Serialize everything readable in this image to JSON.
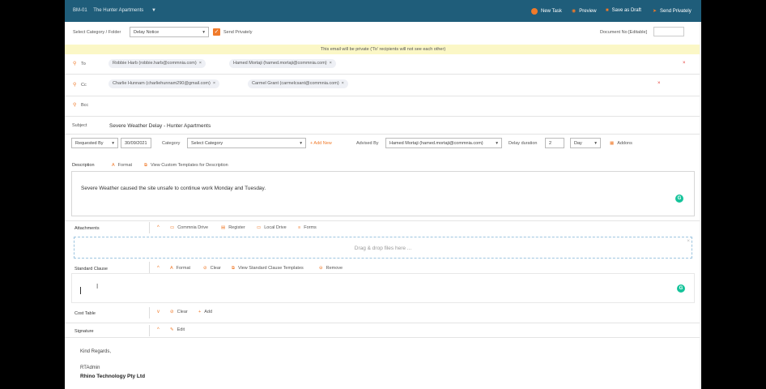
{
  "topbar": {
    "code": "BM-01",
    "project": "The Hunter Apartments",
    "actions": {
      "new_task": "New Task",
      "preview": "Preview",
      "save_draft": "Save as Draft",
      "send_privately": "Send Privately"
    }
  },
  "form": {
    "category_label": "Select Category / Folder",
    "category_value": "Delay Notice",
    "send_privately_label": "Send Privately",
    "document_no_label": "Document No [Editable]",
    "private_banner": "This email will be private ('To' recipients will not see each other)",
    "to_label": "To",
    "to_recipients": [
      "Robbie Harb (robbie.harb@commnia.com)",
      "Hamed Mortaji (hamed.mortaji@commnia.com)"
    ],
    "cc_label": "Cc",
    "cc_recipients": [
      "Charlie Hunnam (charliehunnam290@gmail.com)",
      "Carmel Grant (carmelcsant@commnia.com)"
    ],
    "bcc_label": "Bcc",
    "subject_label": "Subject",
    "subject_value": "Severe Weather Delay - Hunter Apartments",
    "requested_by_value": "Requested By",
    "date_value": "30/09/2021",
    "category2_label": "Category",
    "category2_value": "Select Category",
    "add_new": "+ Add New",
    "advised_by_label": "Advised By",
    "advised_by_value": "Hamed Mortaji (hamed.mortaji@commnia.com)",
    "delay_duration_label": "Delay duration",
    "delay_duration_value": "2",
    "unit_value": "Day",
    "addons": "Addons",
    "description_label": "Description",
    "format": "Format",
    "view_custom_templates": "View Custom Templates for Description",
    "description_text": "Severe Weather caused the site unsafe to continue work Monday and Tuesday.",
    "attachments_label": "Attachments",
    "attach_actions": [
      "Commnia Drive",
      "Register",
      "Local Drive",
      "Forms"
    ],
    "dropzone_text": "Drag & drop files here ...",
    "standard_clause_label": "Standard Clause",
    "clause_actions": [
      "Format",
      "Clear",
      "View Standard Clause Templates",
      "Remove"
    ],
    "cost_table_label": "Cost Table",
    "cost_actions": [
      "Clear",
      "Add"
    ],
    "signature_label": "Signature",
    "edit": "Edit",
    "signature_lines": [
      "Kind Regards,",
      "RTAdmin",
      "Rhino Technology Pty Ltd"
    ]
  },
  "colors": {
    "topbar": "#1f5d7a",
    "accent": "#f07a2a",
    "banner": "#fbf7c6"
  }
}
